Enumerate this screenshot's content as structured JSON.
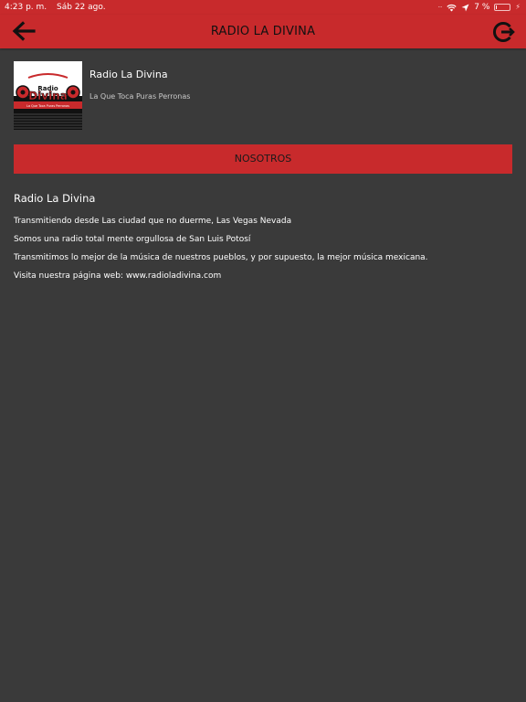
{
  "status_bar": {
    "time": "4:23 p. m.",
    "date": "Sáb 22 ago.",
    "battery_percent": "7 %",
    "battery_level": 0.07
  },
  "nav": {
    "title": "RADIO LA DIVINA",
    "back_icon": "arrow-left-icon",
    "exit_icon": "exit-icon"
  },
  "station": {
    "name": "Radio La Divina",
    "slogan": "La Que Toca Puras Perronas",
    "logo": {
      "top_text": "Radio",
      "main_text": "Divina",
      "bottom_text": "La Que Toca Puras Perronas"
    }
  },
  "tab_button": {
    "label": "NOSOTROS"
  },
  "about": {
    "title": "Radio La Divina",
    "lines": [
      "Transmitiendo desde Las ciudad que no duerme, Las Vegas Nevada",
      "Somos una radio total mente orgullosa de San Luis Potosí",
      "Transmitimos lo mejor de la música de nuestros pueblos, y por supuesto, la mejor música mexicana.",
      "Visita nuestra página web: www.radioladivina.com"
    ]
  },
  "colors": {
    "accent": "#c82a2c",
    "background": "#3a3a3a",
    "text": "#ffffff",
    "muted_text": "#c9c9c9"
  }
}
